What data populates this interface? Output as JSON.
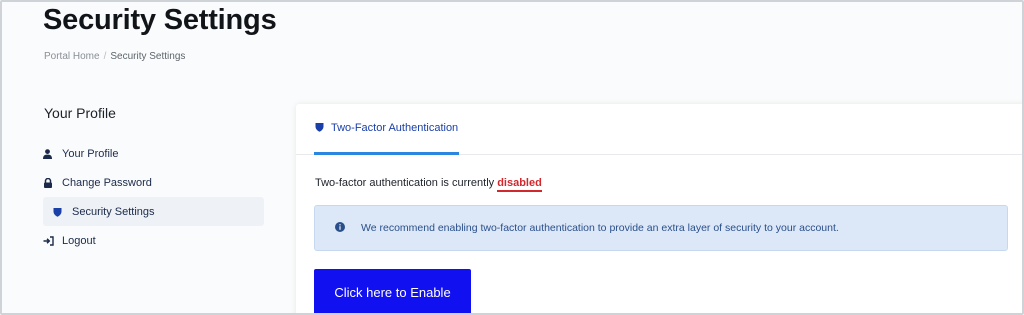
{
  "header": {
    "title": "Security Settings",
    "breadcrumb": [
      {
        "label": "Portal Home"
      },
      {
        "label": "Security Settings"
      }
    ],
    "breadcrumb_separator": "/"
  },
  "sidebar": {
    "heading": "Your Profile",
    "items": [
      {
        "label": "Your Profile",
        "icon": "user-icon"
      },
      {
        "label": "Change Password",
        "icon": "lock-icon"
      },
      {
        "label": "Security Settings",
        "icon": "shield-icon",
        "active": true
      },
      {
        "label": "Logout",
        "icon": "sign-out-icon"
      }
    ]
  },
  "main": {
    "tab_label": "Two-Factor Authentication",
    "status_prefix": "Two-factor authentication is currently ",
    "status_value": "disabled",
    "info_message": "We recommend enabling two-factor authentication to provide an extra layer of security to your account.",
    "enable_button_label": "Click here to Enable"
  },
  "colors": {
    "accent": "#1010f0",
    "tab_underline": "#2b86e0",
    "status_disabled": "#d1282e",
    "alert_bg": "#dce8f8"
  }
}
